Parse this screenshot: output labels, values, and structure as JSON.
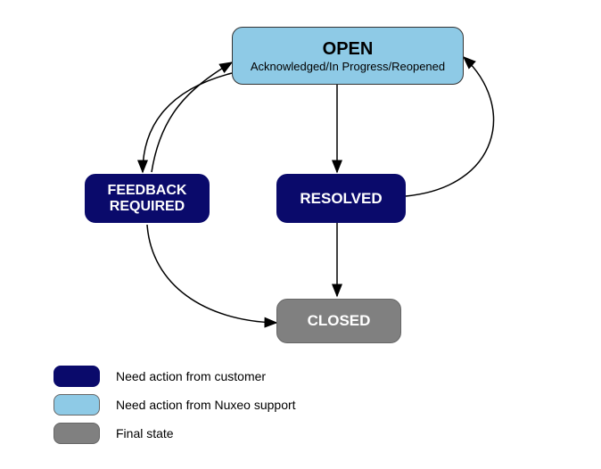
{
  "nodes": {
    "open": {
      "title": "OPEN",
      "subtitle": "Acknowledged/In Progress/Reopened"
    },
    "feedback": {
      "line1": "FEEDBACK",
      "line2": "REQUIRED"
    },
    "resolved": {
      "title": "RESOLVED"
    },
    "closed": {
      "title": "CLOSED"
    }
  },
  "legend": {
    "dark": "Need action from customer",
    "light": "Need action from Nuxeo support",
    "gray": "Final state"
  },
  "colors": {
    "dark": "#0a0a6b",
    "light": "#8ecae6",
    "gray": "#808080"
  }
}
